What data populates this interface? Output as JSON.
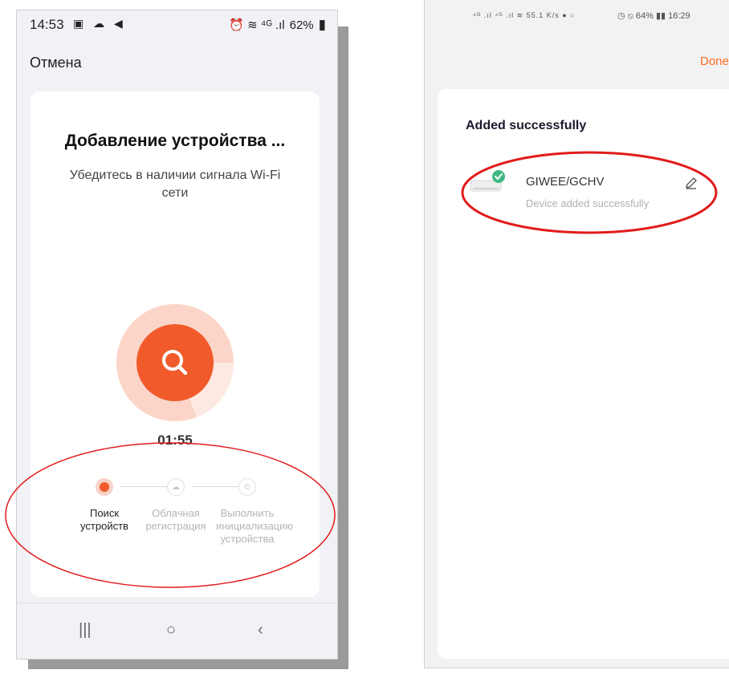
{
  "left_screen": {
    "status_bar": {
      "time": "14:53",
      "left_icons": "▣ ☁ ◀",
      "right_icons": "⏰ ≋ ⁴ᴳ .ıl",
      "battery": "62%"
    },
    "cancel_label": "Отмена",
    "title": "Добавление устройства ...",
    "subtitle": "Убедитесь в наличии сигнала Wi-Fi сети",
    "timer": "01:55",
    "steps": [
      {
        "label": "Поиск устройств",
        "state": "active"
      },
      {
        "label": "Облачная регистрация",
        "state": "inactive"
      },
      {
        "label": "Выполнить инициализацию устройства",
        "state": "inactive"
      }
    ],
    "nav": {
      "recents": "|||",
      "home": "○",
      "back": "‹"
    },
    "accent_color": "#f15a2b"
  },
  "right_screen": {
    "status_bar": {
      "left": "⁴ᴳ .ıl ⁴ᴳ .ıl ≋ 55.1 K/s ● ○",
      "right": "◷ ⦸ 64% ▮▮ 16:29"
    },
    "done_label": "Done",
    "heading": "Added successfully",
    "device": {
      "name": "GIWEE/GCHV",
      "status": "Device added successfully",
      "icon": "air-conditioner-icon",
      "check_color": "#41b883"
    },
    "accent_color": "#ff6a1e"
  },
  "annotation_color": "#e11b1b"
}
